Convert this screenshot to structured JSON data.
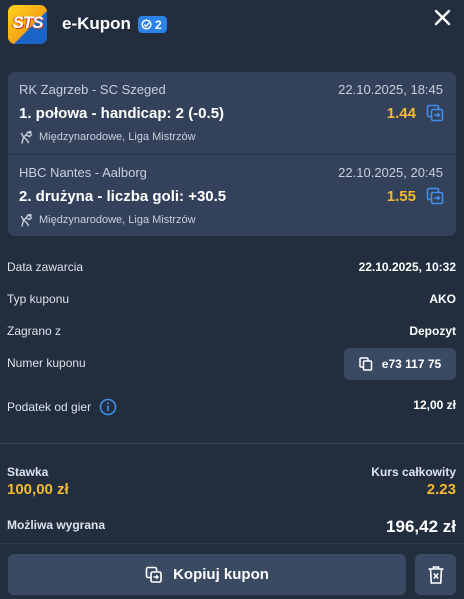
{
  "header": {
    "logo_text": "STS",
    "title": "e-Kupon",
    "badge_count": "2"
  },
  "bets": [
    {
      "teams": "RK Zagrzeb - SC Szeged",
      "datetime": "22.10.2025, 18:45",
      "market": "1. połowa - handicap: 2 (-0.5)",
      "odds": "1.44",
      "league": "Międzynarodowe, Liga Mistrzów",
      "sport_icon": "handball-icon"
    },
    {
      "teams": "HBC Nantes - Aalborg",
      "datetime": "22.10.2025, 20:45",
      "market": "2. drużyna - liczba goli: +30.5",
      "odds": "1.55",
      "league": "Międzynarodowe, Liga Mistrzów",
      "sport_icon": "handball-icon"
    }
  ],
  "details": {
    "date_label": "Data zawarcia",
    "date_value": "22.10.2025, 10:32",
    "type_label": "Typ kuponu",
    "type_value": "AKO",
    "source_label": "Zagrano z",
    "source_value": "Depozyt",
    "number_label": "Numer kuponu",
    "number_value": "e73 117 75",
    "tax_label": "Podatek od gier",
    "tax_value": "12,00 zł"
  },
  "summary": {
    "stake_label": "Stawka",
    "stake_value": "100,00 zł",
    "total_odds_label": "Kurs całkowity",
    "total_odds_value": "2.23",
    "win_label": "Możliwa wygrana",
    "win_value": "196,42 zł"
  },
  "actions": {
    "copy_label": "Kopiuj kupon"
  },
  "colors": {
    "background": "#222d3e",
    "card": "#33425a",
    "accent_odds": "#f3b934",
    "badge": "#2d82e8",
    "button": "#3a4a63"
  }
}
